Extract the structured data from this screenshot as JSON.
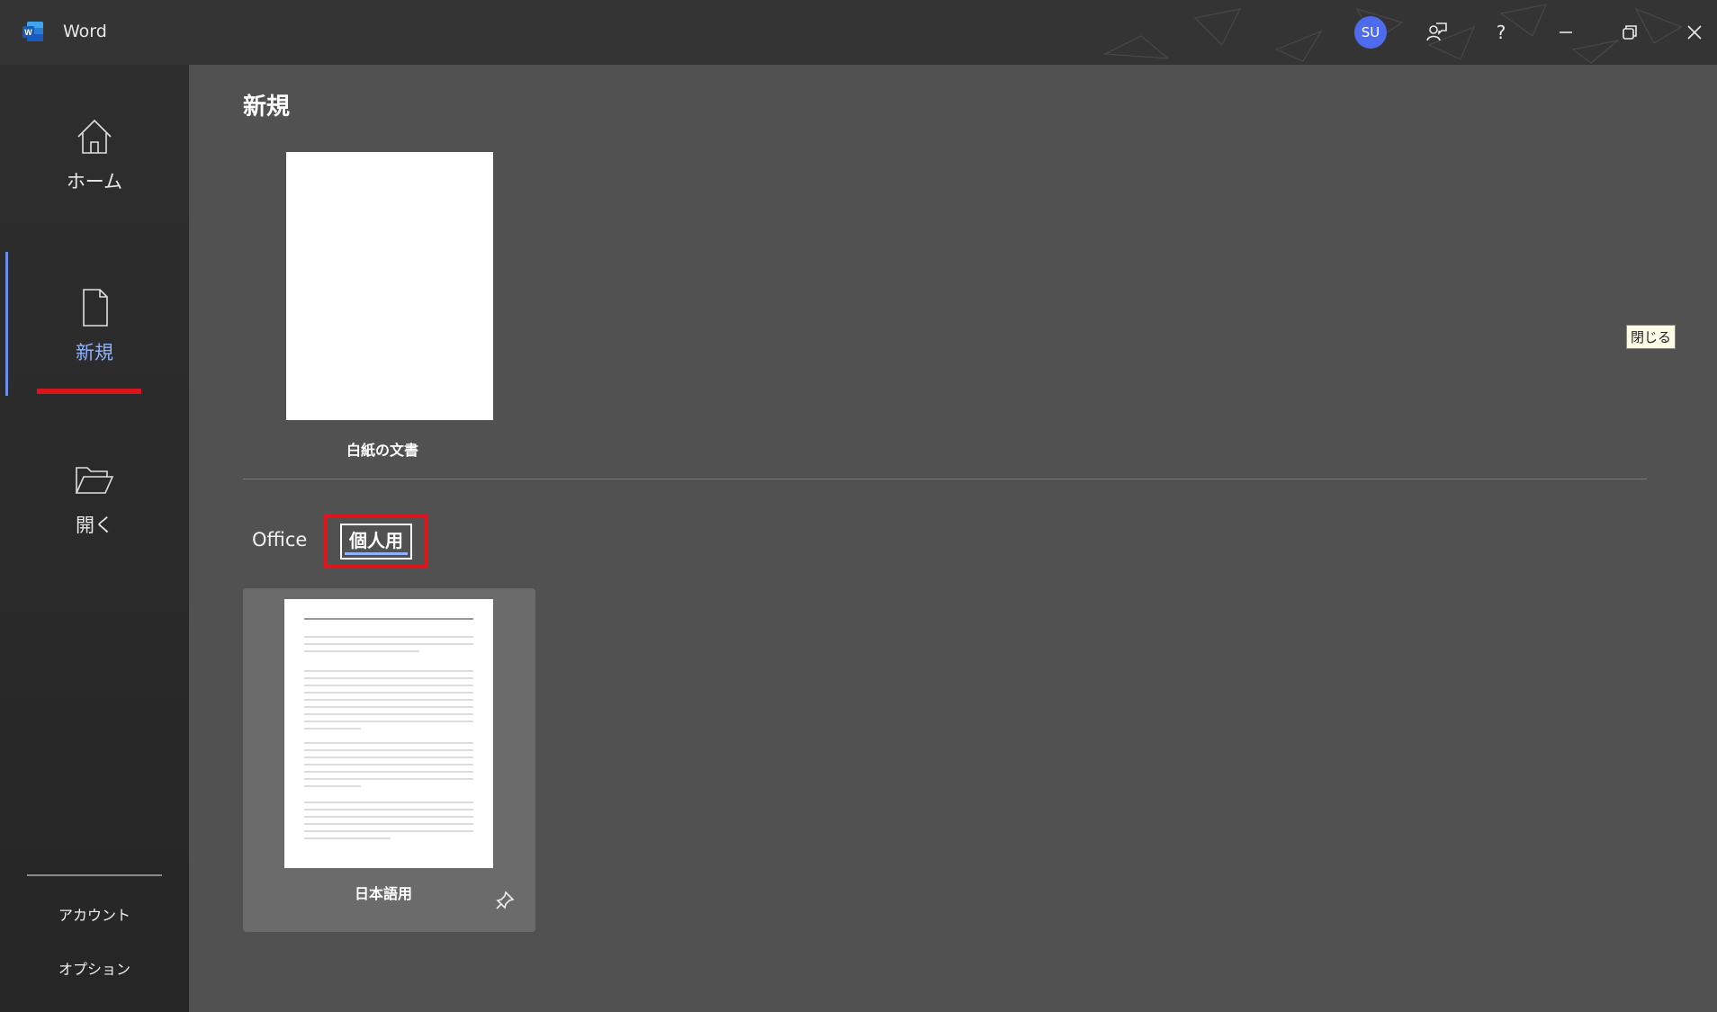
{
  "app": {
    "title": "Word",
    "avatar_initials": "SU"
  },
  "titlebar_icons": [
    "word-logo-icon",
    "feedback-icon",
    "help-icon",
    "minimize-icon",
    "restore-icon",
    "close-icon"
  ],
  "help_label": "?",
  "sidebar": {
    "items": [
      {
        "label": "ホーム",
        "icon": "home-icon"
      },
      {
        "label": "新規",
        "icon": "new-document-icon",
        "active": true
      },
      {
        "label": "開く",
        "icon": "folder-open-icon"
      }
    ],
    "footer": {
      "account": "アカウント",
      "options": "オプション"
    }
  },
  "main": {
    "title": "新規",
    "blank_doc_label": "白紙の文書",
    "tabs": [
      {
        "label": "Office"
      },
      {
        "label": "個人用",
        "selected": true
      }
    ],
    "templates": [
      {
        "label": "日本語用",
        "pin_icon": "pin-icon"
      }
    ]
  },
  "tooltip": {
    "text": "閉じる"
  },
  "colors": {
    "accent": "#8fb3ff",
    "highlight_red": "#e0141c",
    "avatar_bg": "#4f6bed"
  }
}
